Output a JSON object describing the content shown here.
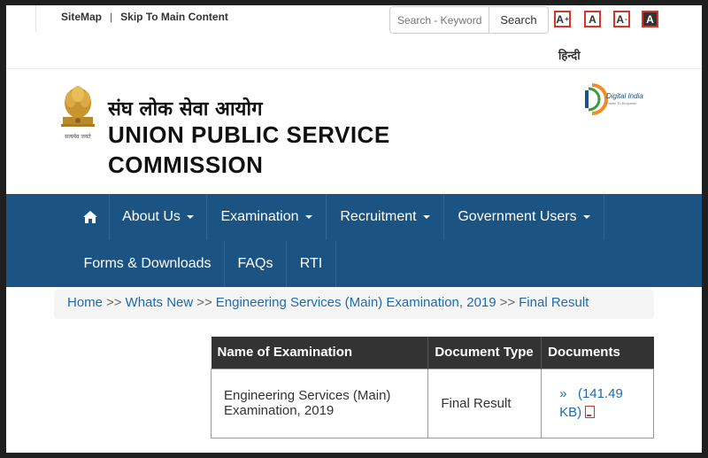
{
  "topbar": {
    "sitemap": "SiteMap",
    "separator": "|",
    "skip": "Skip To Main Content",
    "search_placeholder": "Search - Keyword",
    "search_button": "Search",
    "font_increase": "A",
    "font_normal": "A",
    "font_decrease": "A",
    "contrast": "A",
    "hindi": "हिन्दी"
  },
  "header": {
    "emblem_caption": "सत्यमेव जयते",
    "title_hindi": "संघ लोक सेवा आयोग",
    "title_line1": "UNION PUBLIC SERVICE",
    "title_line2": "COMMISSION",
    "digital_india": "Digital India",
    "digital_india_tagline": "Power To Empower"
  },
  "nav": {
    "home_icon": "home-icon",
    "items": [
      {
        "label": "About Us",
        "dropdown": true
      },
      {
        "label": "Examination",
        "dropdown": true
      },
      {
        "label": "Recruitment",
        "dropdown": true
      },
      {
        "label": "Government Users",
        "dropdown": true
      },
      {
        "label": "Forms & Downloads",
        "dropdown": false
      },
      {
        "label": "FAQs",
        "dropdown": false
      },
      {
        "label": "RTI",
        "dropdown": false
      }
    ]
  },
  "breadcrumb": {
    "items": [
      "Home",
      "Whats New",
      "Engineering Services (Main) Examination, 2019",
      "Final Result"
    ],
    "sep": ">>"
  },
  "table": {
    "headers": [
      "Name of Examination",
      "Document Type",
      "Documents"
    ],
    "rows": [
      {
        "name_line1": "Engineering Services (Main)",
        "name_line2": "Examination, 2019",
        "type": "Final Result",
        "doc_prefix": "»",
        "doc_size_line1": "(141.49",
        "doc_size_line2": "KB)"
      }
    ]
  },
  "colors": {
    "nav_bg": "#1b5382",
    "link": "#1e6aad",
    "table_header": "#333333",
    "font_btn_border": "#d9342b"
  }
}
